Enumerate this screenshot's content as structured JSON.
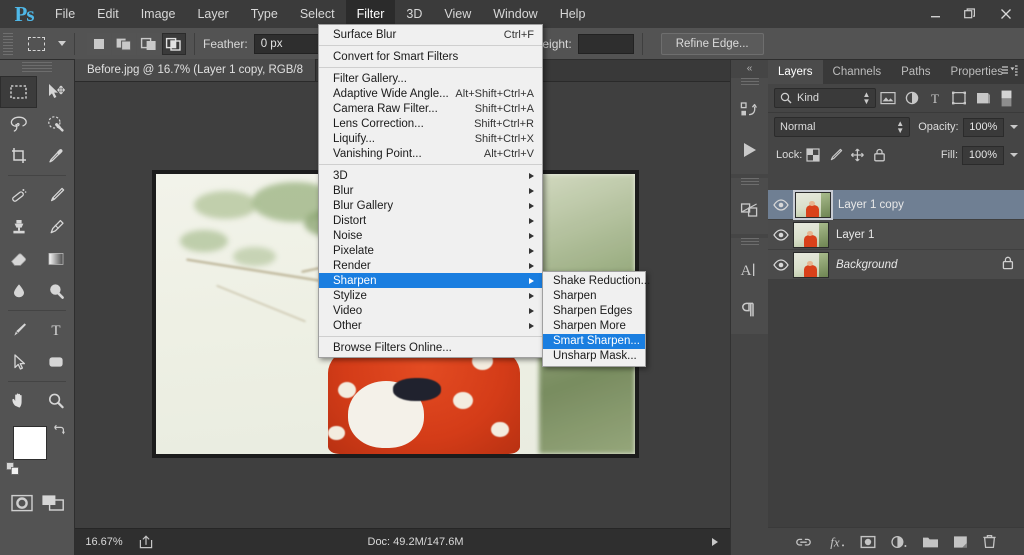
{
  "app": {
    "logo": "Ps"
  },
  "menubar": {
    "items": [
      {
        "label": "File",
        "active": false
      },
      {
        "label": "Edit",
        "active": false
      },
      {
        "label": "Image",
        "active": false
      },
      {
        "label": "Layer",
        "active": false
      },
      {
        "label": "Type",
        "active": false
      },
      {
        "label": "Select",
        "active": false
      },
      {
        "label": "Filter",
        "active": true
      },
      {
        "label": "3D",
        "active": false
      },
      {
        "label": "View",
        "active": false
      },
      {
        "label": "Window",
        "active": false
      },
      {
        "label": "Help",
        "active": false
      }
    ]
  },
  "window_controls": {
    "minimize": "minimize-icon",
    "restore": "restore-icon",
    "close": "close-icon"
  },
  "options_bar": {
    "tool": "rectangular-marquee-tool",
    "selection_modes": [
      "new-selection",
      "add-to-selection",
      "subtract-from-selection",
      "intersect-with-selection"
    ],
    "active_selection_mode_index": 3,
    "feather_label": "Feather:",
    "feather_value": "0 px",
    "style_value": "",
    "width_value": "",
    "height_label": "Height:",
    "height_value": "",
    "refine_edge_label": "Refine Edge..."
  },
  "filter_menu": {
    "groups": [
      [
        {
          "label": "Surface Blur",
          "shortcut": "Ctrl+F",
          "submenu": false,
          "highlight": false
        }
      ],
      [
        {
          "label": "Convert for Smart Filters",
          "shortcut": "",
          "submenu": false,
          "highlight": false
        }
      ],
      [
        {
          "label": "Filter Gallery...",
          "shortcut": "",
          "submenu": false,
          "highlight": false
        },
        {
          "label": "Adaptive Wide Angle...",
          "shortcut": "Alt+Shift+Ctrl+A",
          "submenu": false,
          "highlight": false
        },
        {
          "label": "Camera Raw Filter...",
          "shortcut": "Shift+Ctrl+A",
          "submenu": false,
          "highlight": false
        },
        {
          "label": "Lens Correction...",
          "shortcut": "Shift+Ctrl+R",
          "submenu": false,
          "highlight": false
        },
        {
          "label": "Liquify...",
          "shortcut": "Shift+Ctrl+X",
          "submenu": false,
          "highlight": false
        },
        {
          "label": "Vanishing Point...",
          "shortcut": "Alt+Ctrl+V",
          "submenu": false,
          "highlight": false
        }
      ],
      [
        {
          "label": "3D",
          "shortcut": "",
          "submenu": true,
          "highlight": false
        },
        {
          "label": "Blur",
          "shortcut": "",
          "submenu": true,
          "highlight": false
        },
        {
          "label": "Blur Gallery",
          "shortcut": "",
          "submenu": true,
          "highlight": false
        },
        {
          "label": "Distort",
          "shortcut": "",
          "submenu": true,
          "highlight": false
        },
        {
          "label": "Noise",
          "shortcut": "",
          "submenu": true,
          "highlight": false
        },
        {
          "label": "Pixelate",
          "shortcut": "",
          "submenu": true,
          "highlight": false
        },
        {
          "label": "Render",
          "shortcut": "",
          "submenu": true,
          "highlight": false
        },
        {
          "label": "Sharpen",
          "shortcut": "",
          "submenu": true,
          "highlight": true
        },
        {
          "label": "Stylize",
          "shortcut": "",
          "submenu": true,
          "highlight": false
        },
        {
          "label": "Video",
          "shortcut": "",
          "submenu": true,
          "highlight": false
        },
        {
          "label": "Other",
          "shortcut": "",
          "submenu": true,
          "highlight": false
        }
      ],
      [
        {
          "label": "Browse Filters Online...",
          "shortcut": "",
          "submenu": false,
          "highlight": false
        }
      ]
    ]
  },
  "sharpen_submenu": {
    "items": [
      {
        "label": "Shake Reduction...",
        "highlight": false
      },
      {
        "label": "Sharpen",
        "highlight": false
      },
      {
        "label": "Sharpen Edges",
        "highlight": false
      },
      {
        "label": "Sharpen More",
        "highlight": false
      },
      {
        "label": "Smart Sharpen...",
        "highlight": true
      },
      {
        "label": "Unsharp Mask...",
        "highlight": false
      }
    ]
  },
  "toolbar": {
    "tools": [
      {
        "name": "rectangular-marquee-tool",
        "selected": true
      },
      {
        "name": "move-tool",
        "selected": false
      },
      {
        "name": "lasso-tool",
        "selected": false
      },
      {
        "name": "quick-selection-tool",
        "selected": false
      },
      {
        "name": "crop-tool",
        "selected": false
      },
      {
        "name": "eyedropper-tool",
        "selected": false
      },
      {
        "name": "spot-healing-brush-tool",
        "selected": false
      },
      {
        "name": "brush-tool",
        "selected": false
      },
      {
        "name": "clone-stamp-tool",
        "selected": false
      },
      {
        "name": "history-brush-tool",
        "selected": false
      },
      {
        "name": "eraser-tool",
        "selected": false
      },
      {
        "name": "gradient-tool",
        "selected": false
      },
      {
        "name": "blur-tool",
        "selected": false
      },
      {
        "name": "dodge-tool",
        "selected": false
      },
      {
        "name": "pen-tool",
        "selected": false
      },
      {
        "name": "horizontal-type-tool",
        "selected": false
      },
      {
        "name": "path-selection-tool",
        "selected": false
      },
      {
        "name": "rounded-rectangle-tool",
        "selected": false
      },
      {
        "name": "hand-tool",
        "selected": false
      },
      {
        "name": "zoom-tool",
        "selected": false
      }
    ],
    "foreground_color": "#ffffff",
    "background_color": "#ffffff",
    "quick_mask": "edit-in-quick-mask-mode",
    "screen_mode": "change-screen-mode"
  },
  "document": {
    "tab_title": "Before.jpg @ 16.7% (Layer 1 copy, RGB/8"
  },
  "status_bar": {
    "zoom": "16.67%",
    "doc": "Doc: 49.2M/147.6M"
  },
  "icon_dock": {
    "items": [
      {
        "name": "history-panel-icon"
      },
      {
        "name": "actions-panel-icon"
      },
      {
        "name": "adjustments-panel-icon"
      },
      {
        "name": "character-panel-icon"
      },
      {
        "name": "paragraph-panel-icon"
      }
    ]
  },
  "layers_panel": {
    "tabs": [
      {
        "label": "Layers",
        "active": true
      },
      {
        "label": "Channels",
        "active": false
      },
      {
        "label": "Paths",
        "active": false
      },
      {
        "label": "Properties",
        "active": false
      }
    ],
    "filter_kind_label": "Kind",
    "filter_icons": [
      "filter-pixel-layers-icon",
      "filter-adjustment-layers-icon",
      "filter-type-layers-icon",
      "filter-shape-layers-icon",
      "filter-smart-objects-icon"
    ],
    "blend_mode": "Normal",
    "opacity_label": "Opacity:",
    "opacity_value": "100%",
    "lock_label": "Lock:",
    "lock_icons": [
      "lock-transparent-pixels-icon",
      "lock-image-pixels-icon",
      "lock-position-icon",
      "lock-all-icon"
    ],
    "fill_label": "Fill:",
    "fill_value": "100%",
    "layers": [
      {
        "name": "Layer 1 copy",
        "visible": true,
        "selected": true,
        "locked": false,
        "italic": false
      },
      {
        "name": "Layer 1",
        "visible": true,
        "selected": false,
        "locked": false,
        "italic": false
      },
      {
        "name": "Background",
        "visible": true,
        "selected": false,
        "locked": true,
        "italic": true
      }
    ],
    "bottom_icons": [
      {
        "name": "link-layers-icon"
      },
      {
        "name": "layer-style-fx-icon"
      },
      {
        "name": "add-layer-mask-icon"
      },
      {
        "name": "new-adjustment-layer-icon"
      },
      {
        "name": "new-group-icon"
      },
      {
        "name": "new-layer-icon"
      },
      {
        "name": "delete-layer-icon"
      }
    ]
  },
  "colors": {
    "menu_highlight": "#1a7ee0",
    "panel_bg": "#454545",
    "chrome_bg": "#535353",
    "selected_layer": "#6f7f93"
  }
}
